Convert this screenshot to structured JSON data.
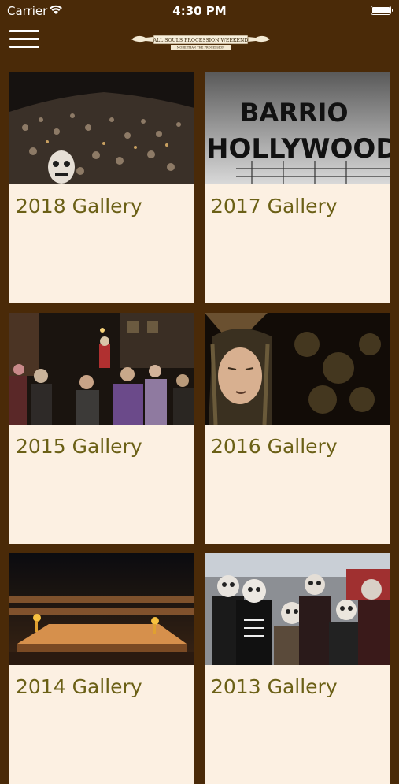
{
  "status": {
    "carrier": "Carrier",
    "time": "4:30 PM"
  },
  "header": {
    "logo_text": "ALL SOULS PROCESSION WEEKEND",
    "logo_subtext": "MORE THAN THE PROCESSION",
    "menu_icon": "hamburger-menu-icon"
  },
  "galleries": [
    {
      "label": "2018 Gallery"
    },
    {
      "label": "2017 Gallery"
    },
    {
      "label": "2015 Gallery"
    },
    {
      "label": "2016 Gallery"
    },
    {
      "label": "2014 Gallery"
    },
    {
      "label": "2013 Gallery"
    }
  ],
  "photo_text": {
    "sign_line1": "BARRIO",
    "sign_line2": "HOLLYWOOD"
  },
  "colors": {
    "background": "#4a2a08",
    "card": "#fcf0e2",
    "title": "#6b6016"
  }
}
